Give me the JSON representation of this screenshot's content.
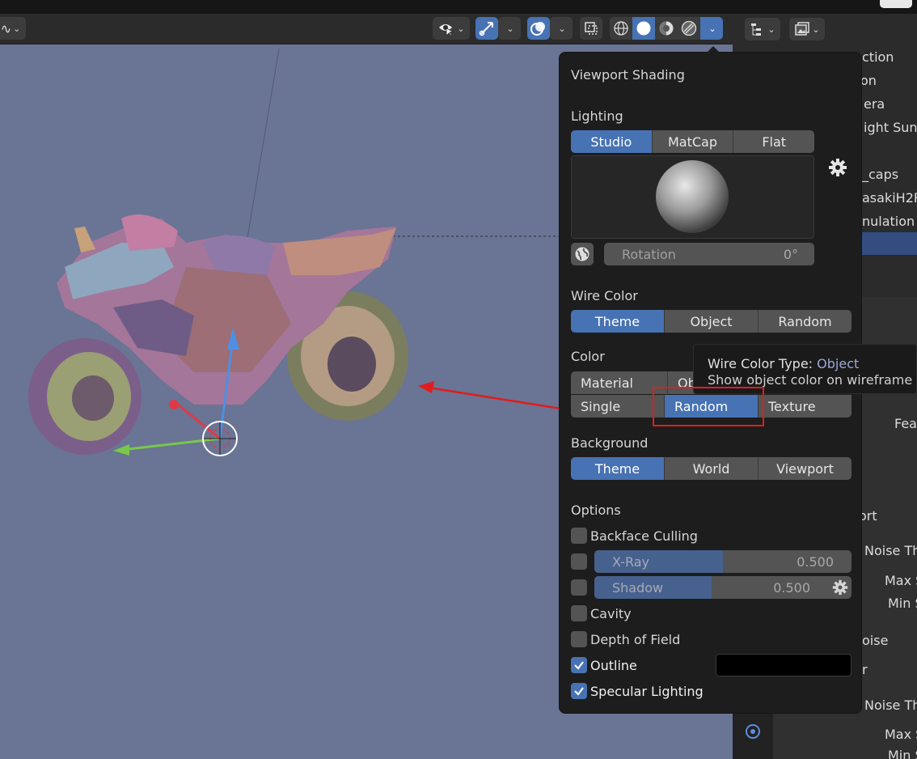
{
  "header": {
    "left_glyph": "∿",
    "buttons": [
      {
        "name": "selectability-visibility",
        "icon": "eye-cursor-icon"
      },
      {
        "name": "gizmo",
        "icon": "gizmo-arrow-icon"
      },
      {
        "name": "overlays",
        "icon": "overlays-icon"
      },
      {
        "name": "xray-toggle",
        "icon": "xray-icon"
      },
      {
        "name": "shading-wireframe",
        "icon": "wireframe-sphere-icon"
      },
      {
        "name": "shading-solid",
        "icon": "solid-sphere-icon"
      },
      {
        "name": "shading-material",
        "icon": "material-sphere-icon"
      },
      {
        "name": "shading-rendered",
        "icon": "rendered-sphere-icon"
      },
      {
        "name": "shading-dropdown",
        "icon": "chevron-down-icon"
      }
    ]
  },
  "outliner": {
    "rows": [
      "ction",
      "on",
      "era",
      "ight Sun",
      "_caps",
      "asakiH2R",
      "nulation"
    ]
  },
  "properties": {
    "labels": [
      "Fea",
      "ort",
      "Noise Th",
      "Max S",
      "Min S",
      "oise",
      "r",
      "Noise Th",
      "Max S",
      "Min S"
    ]
  },
  "popover": {
    "title": "Viewport Shading",
    "lighting": {
      "label": "Lighting",
      "options": [
        "Studio",
        "MatCap",
        "Flat"
      ],
      "active": "Studio",
      "rotation_label": "Rotation",
      "rotation_value": "0°"
    },
    "wire_color": {
      "label": "Wire Color",
      "options": [
        "Theme",
        "Object",
        "Random"
      ],
      "active": "Theme"
    },
    "color": {
      "label": "Color",
      "row1": [
        "Material",
        "Obj"
      ],
      "row2": [
        "Single",
        "Random",
        "Texture"
      ],
      "active": "Random"
    },
    "background": {
      "label": "Background",
      "options": [
        "Theme",
        "World",
        "Viewport"
      ],
      "active": "Theme"
    },
    "options": {
      "label": "Options",
      "backface_culling": {
        "label": "Backface Culling",
        "checked": false
      },
      "xray": {
        "label": "X-Ray",
        "value": "0.500",
        "checked": false,
        "fraction": 0.5
      },
      "shadow": {
        "label": "Shadow",
        "value": "0.500",
        "checked": false,
        "fraction": 0.5
      },
      "cavity": {
        "label": "Cavity",
        "checked": false
      },
      "depth_of_field": {
        "label": "Depth of Field",
        "checked": false
      },
      "outline": {
        "label": "Outline",
        "checked": true,
        "color": "#000000"
      },
      "specular_lighting": {
        "label": "Specular Lighting",
        "checked": true
      }
    }
  },
  "tooltip": {
    "title_prefix": "Wire Color Type:",
    "title_value": "Object",
    "description": "Show object color on wireframe"
  },
  "colors": {
    "accent": "#4772b3",
    "viewport_bg": "#6a7494",
    "panel_bg": "#1d1d1d",
    "highlight": "#e01d1d"
  }
}
